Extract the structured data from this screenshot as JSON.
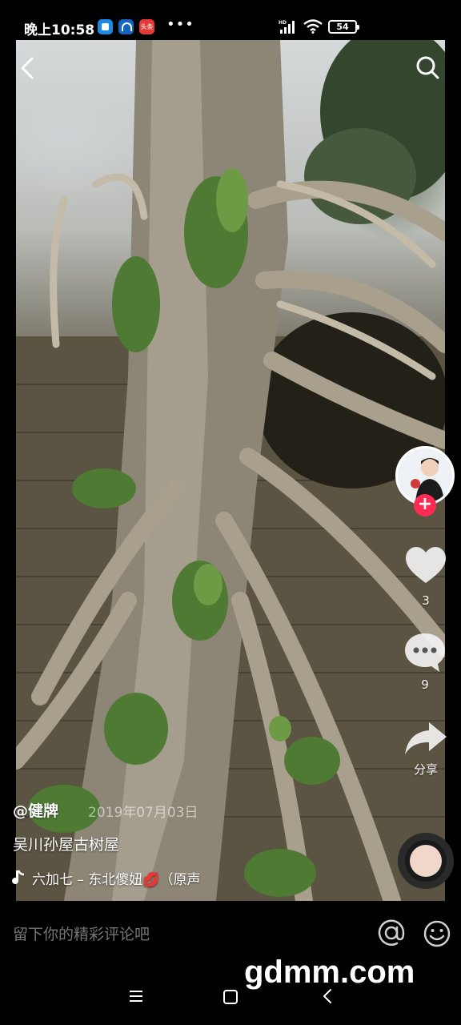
{
  "status_bar": {
    "time": "晚上10:58",
    "app_icons": [
      "app-icon-blue",
      "app-icon-browser",
      "toutiao-icon"
    ],
    "toutiao_label": "头条",
    "more": "•••",
    "network": "HD",
    "battery_level": "54"
  },
  "video": {
    "subject": "banyan-tree-roots-over-brick-wall",
    "back_icon": "chevron-left-icon",
    "search_icon": "search-icon"
  },
  "actions": {
    "follow_symbol": "+",
    "like_count": "3",
    "comment_count": "9",
    "share_label": "分享"
  },
  "post": {
    "author": "@健牌",
    "date": "2019年07月03日",
    "caption": "吴川孙屋古树屋",
    "music": "六加七 – 东北傻妞💋（原声"
  },
  "comment_bar": {
    "placeholder": "留下你的精彩评论吧",
    "at_icon": "at-icon",
    "emoji_icon": "emoji-icon"
  },
  "watermark": "gdmm.com",
  "colors": {
    "accent": "#fe2c55",
    "background": "#000000",
    "placeholder_text": "#8a8a8a"
  }
}
